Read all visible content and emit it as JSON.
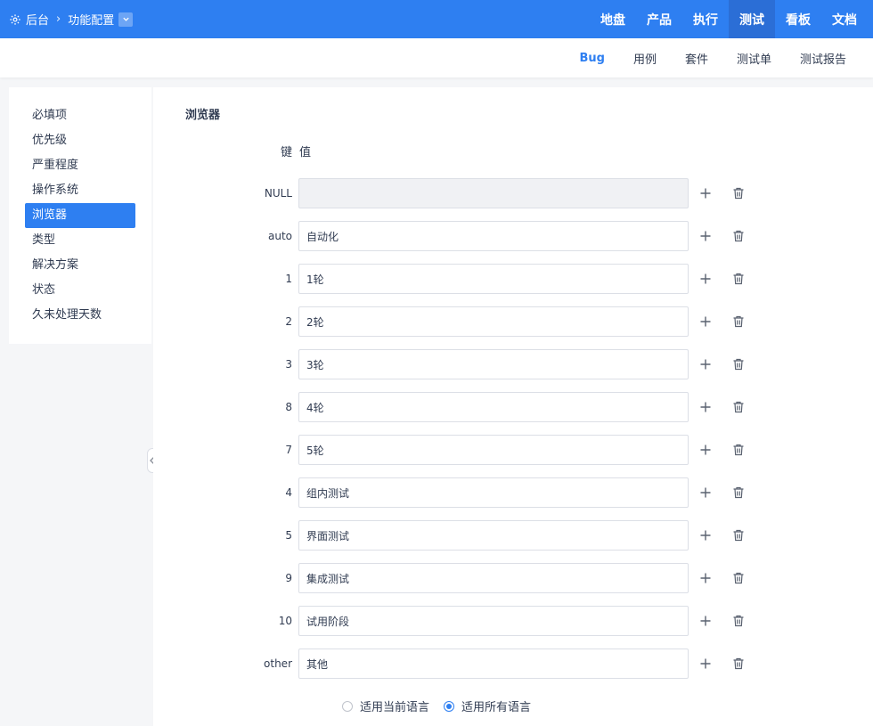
{
  "breadcrumb": {
    "home": "后台",
    "current": "功能配置"
  },
  "topnav": [
    {
      "label": "地盘",
      "active": false
    },
    {
      "label": "产品",
      "active": false
    },
    {
      "label": "执行",
      "active": false
    },
    {
      "label": "测试",
      "active": true
    },
    {
      "label": "看板",
      "active": false
    },
    {
      "label": "文档",
      "active": false
    }
  ],
  "subnav": [
    {
      "label": "Bug",
      "active": true
    },
    {
      "label": "用例",
      "active": false
    },
    {
      "label": "套件",
      "active": false
    },
    {
      "label": "测试单",
      "active": false
    },
    {
      "label": "测试报告",
      "active": false
    }
  ],
  "sidebar": [
    {
      "label": "必填项",
      "active": false
    },
    {
      "label": "优先级",
      "active": false
    },
    {
      "label": "严重程度",
      "active": false
    },
    {
      "label": "操作系统",
      "active": false
    },
    {
      "label": "浏览器",
      "active": true
    },
    {
      "label": "类型",
      "active": false
    },
    {
      "label": "解决方案",
      "active": false
    },
    {
      "label": "状态",
      "active": false
    },
    {
      "label": "久未处理天数",
      "active": false
    }
  ],
  "main": {
    "title": "浏览器",
    "key_header": "键",
    "value_header": "值",
    "rows": [
      {
        "key": "NULL",
        "value": "",
        "disabled": true
      },
      {
        "key": "auto",
        "value": "自动化",
        "disabled": false
      },
      {
        "key": "1",
        "value": "1轮",
        "disabled": false
      },
      {
        "key": "2",
        "value": "2轮",
        "disabled": false
      },
      {
        "key": "3",
        "value": "3轮",
        "disabled": false
      },
      {
        "key": "8",
        "value": "4轮",
        "disabled": false
      },
      {
        "key": "7",
        "value": "5轮",
        "disabled": false
      },
      {
        "key": "4",
        "value": "组内测试",
        "disabled": false
      },
      {
        "key": "5",
        "value": "界面测试",
        "disabled": false
      },
      {
        "key": "9",
        "value": "集成测试",
        "disabled": false
      },
      {
        "key": "10",
        "value": "试用阶段",
        "disabled": false
      },
      {
        "key": "other",
        "value": "其他",
        "disabled": false
      }
    ],
    "lang_options": [
      {
        "label": "适用当前语言",
        "checked": false
      },
      {
        "label": "适用所有语言",
        "checked": true
      }
    ]
  },
  "colors": {
    "brand": "#2e7ff1",
    "brand_active": "#2b6ed6"
  },
  "icons": {
    "gear": "gear-icon",
    "chevron": "chevron-down-icon",
    "add": "plus-icon",
    "remove": "trash-icon",
    "collapse": "chevron-left-icon"
  }
}
